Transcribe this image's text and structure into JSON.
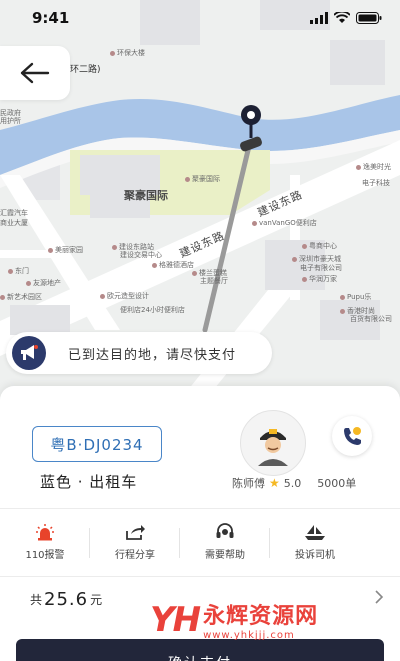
{
  "status_bar": {
    "time": "9:41"
  },
  "map": {
    "labels": {
      "top_building": "环保大楼",
      "ring_road": "环二路)",
      "left1": "民政府",
      "left2": "政大厦",
      "left3": "用护所",
      "left4": "汇霞汽车",
      "left5": "商业大厦",
      "left6": "美丽家园",
      "left7": "东门",
      "left8": "友源地产",
      "left9": "新艺术园区",
      "jubao": "聚豪国际",
      "jubao_small": "聚豪国际",
      "bus1": "建设东路站",
      "bus2": "建设交易中心",
      "school": "格雅德酒店",
      "design": "欧元造型设计",
      "shop24": "便利店24小时便利店",
      "lanji": "楼兰蛋糕",
      "lanji2": "主题餐厅",
      "vanvango": "vanVanGO便利店",
      "yusheng": "粤商中心",
      "shenzhen": "深圳市豪天城",
      "shenzhen2": "电子有限公司",
      "huarun": "华润万家",
      "pupu": "Pupu乐",
      "hexiang": "香港时尚",
      "hexiang2": "百货有限公司",
      "yidong": "逸美时光",
      "yidong2": "电子科技"
    },
    "road_main": "建设东路",
    "road_main2": "建设东路"
  },
  "message": {
    "text": "已到达目的地，请尽快支付"
  },
  "vehicle": {
    "plate": "粤B·DJ0234",
    "description": "蓝色 · 出租车"
  },
  "driver": {
    "name": "陈师傅",
    "rating": "5.0",
    "orders": "5000单"
  },
  "actions": [
    {
      "label": "110报警",
      "icon": "alarm-icon",
      "color": "#e8432b"
    },
    {
      "label": "行程分享",
      "icon": "share-icon",
      "color": "#333333"
    },
    {
      "label": "需要帮助",
      "icon": "headset-icon",
      "color": "#333333"
    },
    {
      "label": "投诉司机",
      "icon": "complaint-icon",
      "color": "#333333"
    }
  ],
  "fare": {
    "prefix": "共",
    "amount": "25.6",
    "unit": "元"
  },
  "confirm_button": {
    "label": "确认支付"
  },
  "watermark": {
    "logo": "YH",
    "title": "永辉资源网",
    "url": "www.yhkjjj.com"
  },
  "colors": {
    "plate_border": "#4a86c8",
    "river": "#a9c5e8",
    "confirm_bg": "#22263a",
    "alarm": "#e8432b",
    "watermark": "#e8322b"
  }
}
